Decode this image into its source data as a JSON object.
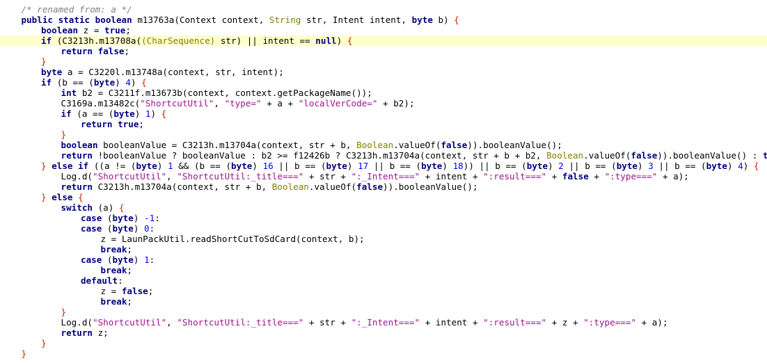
{
  "editor": {
    "highlighted_line": 3,
    "colors": {
      "background": "#ffffff",
      "line_highlight": "#ffffcc",
      "keyword": "#000080",
      "comment": "#808080",
      "string": "#a0128f",
      "number": "#0000ff",
      "class_ref": "#808000",
      "brace": "#cc2200",
      "text": "#000000"
    },
    "lines": [
      {
        "indent": 1,
        "tokens": [
          [
            "cm",
            "/* renamed from: a */"
          ]
        ]
      },
      {
        "indent": 1,
        "tokens": [
          [
            "kw",
            "public static boolean"
          ],
          [
            "plain",
            " m13763a(Context context, "
          ],
          [
            "cls",
            "String"
          ],
          [
            "plain",
            " str, Intent intent, "
          ],
          [
            "kw",
            "byte"
          ],
          [
            "plain",
            " b) "
          ],
          [
            "brace",
            "{"
          ]
        ]
      },
      {
        "indent": 2,
        "tokens": [
          [
            "kw",
            "boolean"
          ],
          [
            "plain",
            " z = "
          ],
          [
            "kw",
            "true"
          ],
          [
            "plain",
            ";"
          ]
        ]
      },
      {
        "indent": 2,
        "tokens": [
          [
            "kw",
            "if"
          ],
          [
            "plain",
            " (C3213h.m13708a("
          ],
          [
            "cls",
            "(CharSequence)"
          ],
          [
            "plain",
            " str) || intent == "
          ],
          [
            "kw",
            "null"
          ],
          [
            "plain",
            ") "
          ],
          [
            "brace",
            "{"
          ]
        ]
      },
      {
        "indent": 3,
        "tokens": [
          [
            "kw",
            "return false"
          ],
          [
            "plain",
            ";"
          ]
        ]
      },
      {
        "indent": 2,
        "tokens": [
          [
            "brace",
            "}"
          ]
        ]
      },
      {
        "indent": 2,
        "tokens": [
          [
            "kw",
            "byte"
          ],
          [
            "plain",
            " a = C3220l.m13748a(context, str, intent);"
          ]
        ]
      },
      {
        "indent": 2,
        "tokens": [
          [
            "kw",
            "if"
          ],
          [
            "plain",
            " (b == ("
          ],
          [
            "kw",
            "byte"
          ],
          [
            "plain",
            ") "
          ],
          [
            "num",
            "4"
          ],
          [
            "plain",
            ") "
          ],
          [
            "brace",
            "{"
          ]
        ]
      },
      {
        "indent": 3,
        "tokens": [
          [
            "kw",
            "int"
          ],
          [
            "plain",
            " b2 = C3211f.m13673b(context, context.getPackageName());"
          ]
        ]
      },
      {
        "indent": 3,
        "tokens": [
          [
            "plain",
            "C3169a.m13482c("
          ],
          [
            "str",
            "\"ShortcutUtil\""
          ],
          [
            "plain",
            ", "
          ],
          [
            "str",
            "\"type=\""
          ],
          [
            "plain",
            " + a + "
          ],
          [
            "str",
            "\"localVerCode=\""
          ],
          [
            "plain",
            " + b2);"
          ]
        ]
      },
      {
        "indent": 3,
        "tokens": [
          [
            "kw",
            "if"
          ],
          [
            "plain",
            " (a == ("
          ],
          [
            "kw",
            "byte"
          ],
          [
            "plain",
            ") "
          ],
          [
            "num",
            "1"
          ],
          [
            "plain",
            ") "
          ],
          [
            "brace",
            "{"
          ]
        ]
      },
      {
        "indent": 4,
        "tokens": [
          [
            "kw",
            "return true"
          ],
          [
            "plain",
            ";"
          ]
        ]
      },
      {
        "indent": 3,
        "tokens": [
          [
            "brace",
            "}"
          ]
        ]
      },
      {
        "indent": 3,
        "tokens": [
          [
            "kw",
            "boolean"
          ],
          [
            "plain",
            " booleanValue = C3213h.m13704a(context, str + b, "
          ],
          [
            "cls",
            "Boolean"
          ],
          [
            "plain",
            ".valueOf("
          ],
          [
            "kw",
            "false"
          ],
          [
            "plain",
            ")).booleanValue();"
          ]
        ]
      },
      {
        "indent": 3,
        "tokens": [
          [
            "kw",
            "return"
          ],
          [
            "plain",
            " !booleanValue ? booleanValue : b2 >= f12426b ? C3213h.m13704a(context, str + b + b2, "
          ],
          [
            "cls",
            "Boolean"
          ],
          [
            "plain",
            ".valueOf("
          ],
          [
            "kw",
            "false"
          ],
          [
            "plain",
            ")).booleanValue() : "
          ],
          [
            "kw",
            "true"
          ],
          [
            "plain",
            ";"
          ]
        ]
      },
      {
        "indent": 2,
        "tokens": [
          [
            "brace",
            "}"
          ],
          [
            "plain",
            " "
          ],
          [
            "kw",
            "else if"
          ],
          [
            "plain",
            " ((a != ("
          ],
          [
            "kw",
            "byte"
          ],
          [
            "plain",
            ") "
          ],
          [
            "num",
            "1"
          ],
          [
            "plain",
            " && (b == ("
          ],
          [
            "kw",
            "byte"
          ],
          [
            "plain",
            ") "
          ],
          [
            "num",
            "16"
          ],
          [
            "plain",
            " || b == ("
          ],
          [
            "kw",
            "byte"
          ],
          [
            "plain",
            ") "
          ],
          [
            "num",
            "17"
          ],
          [
            "plain",
            " || b == ("
          ],
          [
            "kw",
            "byte"
          ],
          [
            "plain",
            ") "
          ],
          [
            "num",
            "18"
          ],
          [
            "plain",
            ")) || b == ("
          ],
          [
            "kw",
            "byte"
          ],
          [
            "plain",
            ") "
          ],
          [
            "num",
            "2"
          ],
          [
            "plain",
            " || b == ("
          ],
          [
            "kw",
            "byte"
          ],
          [
            "plain",
            ") "
          ],
          [
            "num",
            "3"
          ],
          [
            "plain",
            " || b == ("
          ],
          [
            "kw",
            "byte"
          ],
          [
            "plain",
            ") "
          ],
          [
            "num",
            "4"
          ],
          [
            "plain",
            ") "
          ],
          [
            "brace",
            "{"
          ]
        ]
      },
      {
        "indent": 3,
        "tokens": [
          [
            "plain",
            "Log.d("
          ],
          [
            "str",
            "\"ShortcutUtil\""
          ],
          [
            "plain",
            ", "
          ],
          [
            "str",
            "\"ShortcutUtil:_title===\""
          ],
          [
            "plain",
            " + str + "
          ],
          [
            "str",
            "\":_Intent===\""
          ],
          [
            "plain",
            " + intent + "
          ],
          [
            "str",
            "\":result===\""
          ],
          [
            "plain",
            " + "
          ],
          [
            "kw",
            "false"
          ],
          [
            "plain",
            " + "
          ],
          [
            "str",
            "\":type===\""
          ],
          [
            "plain",
            " + a);"
          ]
        ]
      },
      {
        "indent": 3,
        "tokens": [
          [
            "kw",
            "return"
          ],
          [
            "plain",
            " C3213h.m13704a(context, str + b, "
          ],
          [
            "cls",
            "Boolean"
          ],
          [
            "plain",
            ".valueOf("
          ],
          [
            "kw",
            "false"
          ],
          [
            "plain",
            ")).booleanValue();"
          ]
        ]
      },
      {
        "indent": 2,
        "tokens": [
          [
            "brace",
            "}"
          ],
          [
            "plain",
            " "
          ],
          [
            "kw",
            "else"
          ],
          [
            "plain",
            " "
          ],
          [
            "brace",
            "{"
          ]
        ]
      },
      {
        "indent": 3,
        "tokens": [
          [
            "kw",
            "switch"
          ],
          [
            "plain",
            " (a) "
          ],
          [
            "brace",
            "{"
          ]
        ]
      },
      {
        "indent": 4,
        "tokens": [
          [
            "kw",
            "case"
          ],
          [
            "plain",
            " ("
          ],
          [
            "kw",
            "byte"
          ],
          [
            "plain",
            ") "
          ],
          [
            "num",
            "-1"
          ],
          [
            "plain",
            ":"
          ]
        ]
      },
      {
        "indent": 4,
        "tokens": [
          [
            "kw",
            "case"
          ],
          [
            "plain",
            " ("
          ],
          [
            "kw",
            "byte"
          ],
          [
            "plain",
            ") "
          ],
          [
            "num",
            "0"
          ],
          [
            "plain",
            ":"
          ]
        ]
      },
      {
        "indent": 5,
        "tokens": [
          [
            "plain",
            "z = LaunPackUtil.readShortCutToSdCard(context, b);"
          ]
        ]
      },
      {
        "indent": 5,
        "tokens": [
          [
            "kw",
            "break"
          ],
          [
            "plain",
            ";"
          ]
        ]
      },
      {
        "indent": 4,
        "tokens": [
          [
            "kw",
            "case"
          ],
          [
            "plain",
            " ("
          ],
          [
            "kw",
            "byte"
          ],
          [
            "plain",
            ") "
          ],
          [
            "num",
            "1"
          ],
          [
            "plain",
            ":"
          ]
        ]
      },
      {
        "indent": 5,
        "tokens": [
          [
            "kw",
            "break"
          ],
          [
            "plain",
            ";"
          ]
        ]
      },
      {
        "indent": 4,
        "tokens": [
          [
            "kw",
            "default"
          ],
          [
            "plain",
            ":"
          ]
        ]
      },
      {
        "indent": 5,
        "tokens": [
          [
            "plain",
            "z = "
          ],
          [
            "kw",
            "false"
          ],
          [
            "plain",
            ";"
          ]
        ]
      },
      {
        "indent": 5,
        "tokens": [
          [
            "kw",
            "break"
          ],
          [
            "plain",
            ";"
          ]
        ]
      },
      {
        "indent": 3,
        "tokens": [
          [
            "brace",
            "}"
          ]
        ]
      },
      {
        "indent": 3,
        "tokens": [
          [
            "plain",
            "Log.d("
          ],
          [
            "str",
            "\"ShortcutUtil\""
          ],
          [
            "plain",
            ", "
          ],
          [
            "str",
            "\"ShortcutUtil:_title===\""
          ],
          [
            "plain",
            " + str + "
          ],
          [
            "str",
            "\":_Intent===\""
          ],
          [
            "plain",
            " + intent + "
          ],
          [
            "str",
            "\":result===\""
          ],
          [
            "plain",
            " + z + "
          ],
          [
            "str",
            "\":type===\""
          ],
          [
            "plain",
            " + a);"
          ]
        ]
      },
      {
        "indent": 3,
        "tokens": [
          [
            "kw",
            "return"
          ],
          [
            "plain",
            " z;"
          ]
        ]
      },
      {
        "indent": 2,
        "tokens": [
          [
            "brace",
            "}"
          ]
        ]
      },
      {
        "indent": 1,
        "tokens": [
          [
            "brace",
            "}"
          ]
        ]
      }
    ]
  }
}
